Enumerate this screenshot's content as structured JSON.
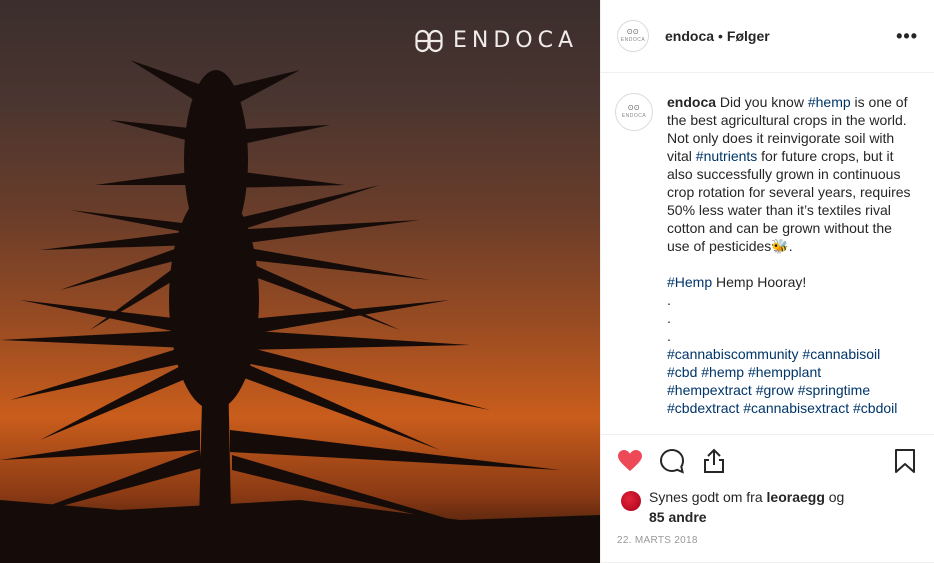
{
  "brand": {
    "text": "ENDOCA",
    "logo_icon": "endoca-logo-icon"
  },
  "header": {
    "avatar_text": "ENDOCA",
    "username": "endoca",
    "separator": "•",
    "follow_label": "Følger",
    "more_label": "•••"
  },
  "caption": {
    "username": "endoca",
    "line1_a": " Did you know ",
    "tag_hemp": "#hemp",
    "line1_b": " is one of the best agricultural crops in the world. Not only does it reinvigorate soil with vital ",
    "tag_nutrients": "#nutrients",
    "line1_c": " for future crops, but it also successfully grown in continuous crop rotation for several years, requires 50% less water than it’s textiles rival cotton and can be grown without the use of pesticides🐝.",
    "tag_Hemp": "#Hemp",
    "hooray": " Hemp Hooray!",
    "dot": ".",
    "tags_line1": [
      "#cannabiscommunity",
      "#cannabisoil"
    ],
    "tags_line2": [
      "#cbd",
      "#hemp",
      "#hempplant"
    ],
    "tags_line3": [
      "#hempextract",
      "#grow",
      "#springtime"
    ],
    "tags_line4": [
      "#cbdextract",
      "#cannabisextract",
      "#cbdoil"
    ]
  },
  "actions": {
    "like_icon": "heart-icon",
    "comment_icon": "comment-icon",
    "share_icon": "share-icon",
    "save_icon": "bookmark-icon",
    "like_color": "#ed4956"
  },
  "likes": {
    "prefix": "Synes godt om fra ",
    "user": "leoraegg",
    "middle": " og",
    "count": "85 andre"
  },
  "date": "22. MARTS 2018"
}
